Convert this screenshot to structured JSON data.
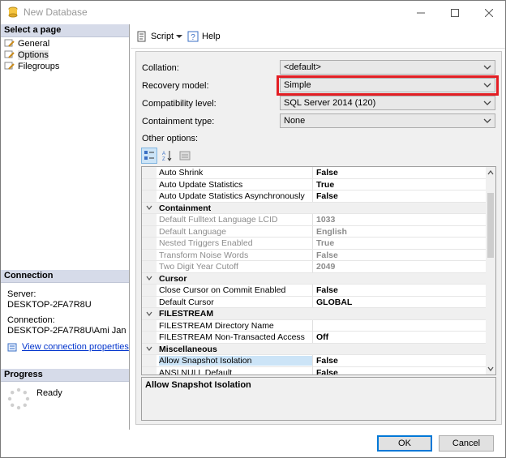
{
  "window": {
    "title": "New Database"
  },
  "left_pane": {
    "select_page_header": "Select a page",
    "pages": [
      {
        "label": "General",
        "icon": "wrench-icon"
      },
      {
        "label": "Options",
        "icon": "wrench-icon",
        "selected": true
      },
      {
        "label": "Filegroups",
        "icon": "wrench-icon"
      }
    ],
    "connection_header": "Connection",
    "server_label": "Server:",
    "server_value": "DESKTOP-2FA7R8U",
    "connection_label": "Connection:",
    "connection_value": "DESKTOP-2FA7R8U\\Ami Jan",
    "view_connection_link": "View connection properties",
    "progress_header": "Progress",
    "progress_status": "Ready"
  },
  "toolbar": {
    "script_label": "Script",
    "help_label": "Help"
  },
  "options": {
    "collation_label": "Collation:",
    "collation_value": "<default>",
    "recovery_label": "Recovery model:",
    "recovery_value": "Simple",
    "compat_label": "Compatibility level:",
    "compat_value": "SQL Server 2014 (120)",
    "containment_label": "Containment type:",
    "containment_value": "None",
    "other_label": "Other options:"
  },
  "grid": {
    "rows": [
      {
        "type": "prop",
        "name": "Auto Shrink",
        "value": "False"
      },
      {
        "type": "prop",
        "name": "Auto Update Statistics",
        "value": "True"
      },
      {
        "type": "prop",
        "name": "Auto Update Statistics Asynchronously",
        "value": "False"
      },
      {
        "type": "cat",
        "name": "Containment"
      },
      {
        "type": "prop",
        "name": "Default Fulltext Language LCID",
        "value": "1033",
        "disabled": true
      },
      {
        "type": "prop",
        "name": "Default Language",
        "value": "English",
        "disabled": true
      },
      {
        "type": "prop",
        "name": "Nested Triggers Enabled",
        "value": "True",
        "disabled": true
      },
      {
        "type": "prop",
        "name": "Transform Noise Words",
        "value": "False",
        "disabled": true
      },
      {
        "type": "prop",
        "name": "Two Digit Year Cutoff",
        "value": "2049",
        "disabled": true
      },
      {
        "type": "cat",
        "name": "Cursor"
      },
      {
        "type": "prop",
        "name": "Close Cursor on Commit Enabled",
        "value": "False"
      },
      {
        "type": "prop",
        "name": "Default Cursor",
        "value": "GLOBAL"
      },
      {
        "type": "cat",
        "name": "FILESTREAM"
      },
      {
        "type": "prop",
        "name": "FILESTREAM Directory Name",
        "value": ""
      },
      {
        "type": "prop",
        "name": "FILESTREAM Non-Transacted Access",
        "value": "Off"
      },
      {
        "type": "cat",
        "name": "Miscellaneous"
      },
      {
        "type": "prop",
        "name": "Allow Snapshot Isolation",
        "value": "False",
        "selected": true
      },
      {
        "type": "prop",
        "name": "ANSI NULL Default",
        "value": "False"
      }
    ],
    "description": "Allow Snapshot Isolation"
  },
  "buttons": {
    "ok": "OK",
    "cancel": "Cancel"
  },
  "colors": {
    "highlight": "#e31e24",
    "header_bg": "#d6dbe9",
    "link": "#0033cc"
  }
}
